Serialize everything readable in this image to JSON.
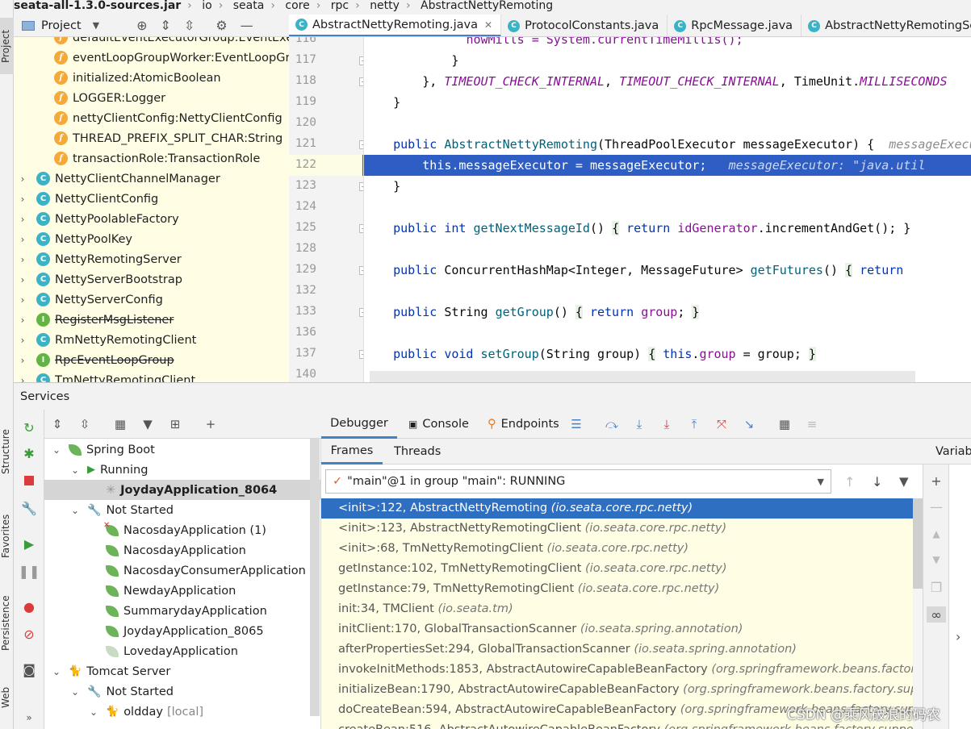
{
  "breadcrumb": [
    "seata-all-1.3.0-sources.jar",
    "io",
    "seata",
    "core",
    "rpc",
    "netty",
    "AbstractNettyRemoting"
  ],
  "left_strip": {
    "project_label": "Project",
    "structure_label": "Structure",
    "favorites_label": "Favorites",
    "persistence_label": "Persistence",
    "web_label": "Web"
  },
  "project": {
    "title": "Project",
    "items": [
      {
        "kind": "field",
        "label": "defaultEventExecutorGroup:EventExecu"
      },
      {
        "kind": "field",
        "label": "eventLoopGroupWorker:EventLoopGrou"
      },
      {
        "kind": "field",
        "label": "initialized:AtomicBoolean"
      },
      {
        "kind": "field",
        "label": "LOGGER:Logger"
      },
      {
        "kind": "field",
        "label": "nettyClientConfig:NettyClientConfig"
      },
      {
        "kind": "field",
        "label": "THREAD_PREFIX_SPLIT_CHAR:String"
      },
      {
        "kind": "field",
        "label": "transactionRole:TransactionRole"
      },
      {
        "kind": "class",
        "label": "NettyClientChannelManager"
      },
      {
        "kind": "class",
        "label": "NettyClientConfig"
      },
      {
        "kind": "class",
        "label": "NettyPoolableFactory"
      },
      {
        "kind": "class",
        "label": "NettyPoolKey"
      },
      {
        "kind": "class",
        "label": "NettyRemotingServer"
      },
      {
        "kind": "class",
        "label": "NettyServerBootstrap"
      },
      {
        "kind": "class",
        "label": "NettyServerConfig"
      },
      {
        "kind": "interface",
        "label": "RegisterMsgListener",
        "deprecated": true
      },
      {
        "kind": "class",
        "label": "RmNettyRemotingClient"
      },
      {
        "kind": "interface",
        "label": "RpcEventLoopGroup",
        "deprecated": true
      },
      {
        "kind": "class",
        "label": "TmNettyRemotingClient"
      }
    ]
  },
  "editor": {
    "tabs": [
      {
        "label": "AbstractNettyRemoting.java",
        "active": true
      },
      {
        "label": "ProtocolConstants.java"
      },
      {
        "label": "RpcMessage.java"
      },
      {
        "label": "AbstractNettyRemotingServe"
      }
    ],
    "line_numbers": [
      "116",
      "117",
      "118",
      "119",
      "120",
      "121",
      "122",
      "123",
      "124",
      "125",
      "128",
      "129",
      "132",
      "133",
      "136",
      "137",
      "140"
    ],
    "current_line": "122",
    "code": {
      "l116_indent": "              ",
      "l116_text": "nowMills = System.currentTimeMillis();",
      "l117": "            }",
      "l118_a": "        }, ",
      "l118_c1": "TIMEOUT_CHECK_INTERNAL",
      "l118_sep": ", ",
      "l118_c2": "TIMEOUT_CHECK_INTERNAL",
      "l118_b": ", TimeUnit.",
      "l118_c3": "MILLISECONDS",
      "l119": "    }",
      "kw_public": "public",
      "kw_this": "this",
      "kw_return": "return",
      "kw_int": "int",
      "kw_void": "void",
      "l121_name": "AbstractNettyRemoting",
      "l121_params": "(ThreadPoolExecutor messageExecutor) {",
      "l121_hint": "messageExecutor",
      "l122_field": "messageExecutor",
      "l122_rest": " = messageExecutor;",
      "l122_hint": "messageExecutor: \"java.util",
      "l123": "    }",
      "l125_name": "getNextMessageId",
      "l125_body_field": "idGenerator",
      "l125_body_rest": ".incrementAndGet(); }",
      "l129_type": "ConcurrentHashMap<Integer, MessageFuture>",
      "l129_name": "getFutures",
      "l133_type": "String",
      "l133_name": "getGroup",
      "l133_field": "group",
      "l137_name": "setGroup",
      "l137_params": "(String group)",
      "l137_field": "group",
      "l137_rest": " = group;"
    }
  },
  "services": {
    "title": "Services",
    "tree": [
      {
        "label": "Spring Boot",
        "type": "group",
        "indent": 0
      },
      {
        "label": "Running",
        "type": "status-running",
        "indent": 1
      },
      {
        "label": "JoydayApplication_8064",
        "type": "app-running",
        "indent": 2,
        "selected": true
      },
      {
        "label": "Not Started",
        "type": "status-stopped",
        "indent": 1
      },
      {
        "label": "NacosdayApplication (1)",
        "type": "app-error",
        "indent": 2
      },
      {
        "label": "NacosdayApplication",
        "type": "app",
        "indent": 2
      },
      {
        "label": "NacosdayConsumerApplication",
        "type": "app",
        "indent": 2
      },
      {
        "label": "NewdayApplication",
        "type": "app",
        "indent": 2
      },
      {
        "label": "SummarydayApplication",
        "type": "app",
        "indent": 2
      },
      {
        "label": "JoydayApplication_8065",
        "type": "app",
        "indent": 2
      },
      {
        "label": "LovedayApplication",
        "type": "app-grey",
        "indent": 2
      },
      {
        "label": "Tomcat Server",
        "type": "tomcat",
        "indent": 0
      },
      {
        "label": "Not Started",
        "type": "status-stopped",
        "indent": 1
      },
      {
        "label": "oldday",
        "suffix": "[local]",
        "type": "tomcat-app",
        "indent": 2
      }
    ]
  },
  "debugger": {
    "tabs": [
      "Debugger",
      "Console",
      "Endpoints"
    ],
    "sub_tabs": [
      "Frames",
      "Threads"
    ],
    "variables_label": "Variabl",
    "thread": "\"main\"@1 in group \"main\": RUNNING",
    "frames": [
      {
        "method": "<init>:122, AbstractNettyRemoting",
        "pkg": "(io.seata.core.rpc.netty)"
      },
      {
        "method": "<init>:123, AbstractNettyRemotingClient",
        "pkg": "(io.seata.core.rpc.netty)"
      },
      {
        "method": "<init>:68, TmNettyRemotingClient",
        "pkg": "(io.seata.core.rpc.netty)"
      },
      {
        "method": "getInstance:102, TmNettyRemotingClient",
        "pkg": "(io.seata.core.rpc.netty)"
      },
      {
        "method": "getInstance:79, TmNettyRemotingClient",
        "pkg": "(io.seata.core.rpc.netty)"
      },
      {
        "method": "init:34, TMClient",
        "pkg": "(io.seata.tm)"
      },
      {
        "method": "initClient:170, GlobalTransactionScanner",
        "pkg": "(io.seata.spring.annotation)"
      },
      {
        "method": "afterPropertiesSet:294, GlobalTransactionScanner",
        "pkg": "(io.seata.spring.annotation)"
      },
      {
        "method": "invokeInitMethods:1853, AbstractAutowireCapableBeanFactory",
        "pkg": "(org.springframework.beans.factory.support)"
      },
      {
        "method": "initializeBean:1790, AbstractAutowireCapableBeanFactory",
        "pkg": "(org.springframework.beans.factory.support)"
      },
      {
        "method": "doCreateBean:594, AbstractAutowireCapableBeanFactory",
        "pkg": "(org.springframework.beans.factory.support)"
      },
      {
        "method": "createBean:516, AbstractAutowireCapableBeanFactory",
        "pkg": "(org.springframework.beans.factory.support)"
      }
    ]
  },
  "watermark": "CSDN @乘风破浪的码农",
  "colors": {
    "accent": "#2e5ec3",
    "selection": "#2e6fc1",
    "tree_bg": "#fffee4"
  }
}
